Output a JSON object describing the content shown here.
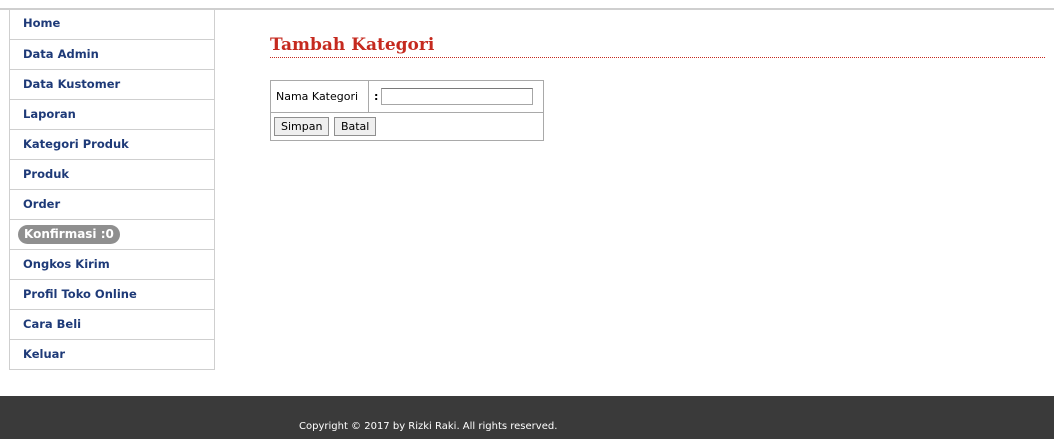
{
  "sidebar": {
    "items": [
      {
        "label": "Home"
      },
      {
        "label": "Data Admin"
      },
      {
        "label": "Data Kustomer"
      },
      {
        "label": "Laporan"
      },
      {
        "label": "Kategori Produk"
      },
      {
        "label": "Produk"
      },
      {
        "label": "Order"
      },
      {
        "label": "Konfirmasi :0"
      },
      {
        "label": "Ongkos Kirim"
      },
      {
        "label": "Profil Toko Online"
      },
      {
        "label": "Cara Beli"
      },
      {
        "label": "Keluar"
      }
    ]
  },
  "main": {
    "title": "Tambah Kategori",
    "form": {
      "field_label": "Nama Kategori",
      "colon": ":",
      "field_value": "",
      "save_label": "Simpan",
      "cancel_label": "Batal"
    }
  },
  "footer": {
    "text": "Copyright © 2017 by Rizki Raki. All rights reserved."
  },
  "colors": {
    "title": "#c52a1f",
    "menu_text": "#1e3a78",
    "footer_bg": "#3a3a3a",
    "badge_bg": "#8f8f8f"
  }
}
